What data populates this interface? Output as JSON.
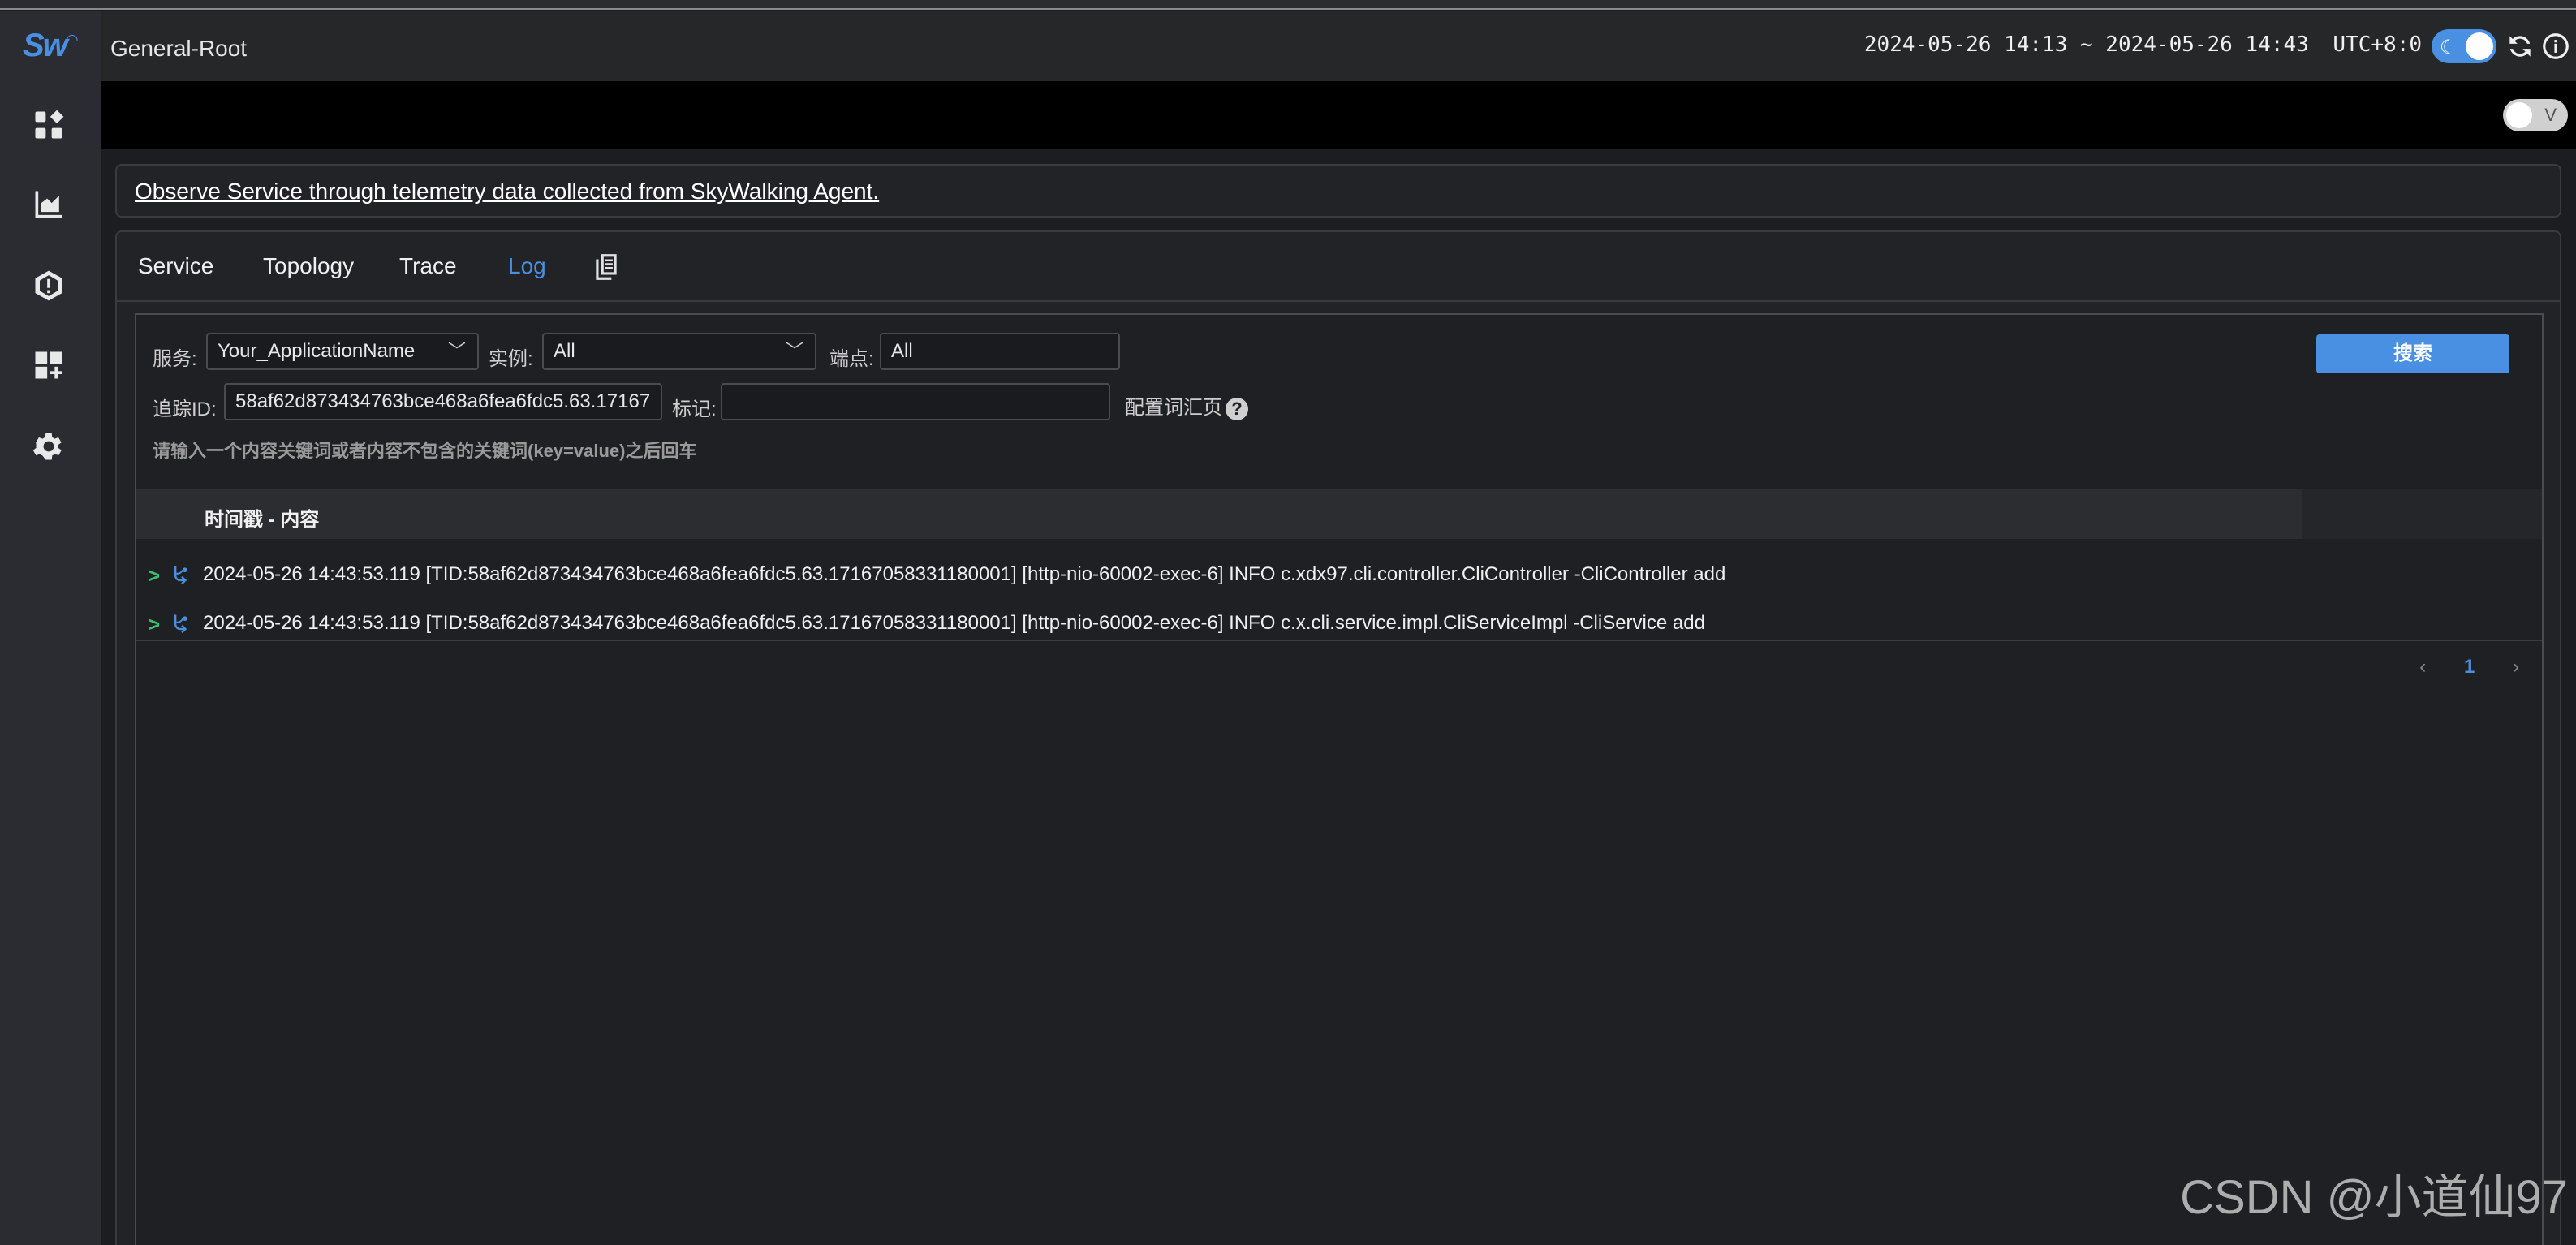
{
  "header": {
    "breadcrumb": "General-Root",
    "time_range": "2024-05-26 14:13 ~ 2024-05-26 14:43",
    "timezone": "UTC+8:0"
  },
  "toggle_label": "V",
  "description": "Observe Service through telemetry data collected from SkyWalking Agent.",
  "tabs": [
    {
      "label": "Service"
    },
    {
      "label": "Topology"
    },
    {
      "label": "Trace"
    },
    {
      "label": "Log",
      "active": true
    }
  ],
  "filters": {
    "service_label": "服务:",
    "service_value": "Your_ApplicationName",
    "instance_label": "实例:",
    "instance_value": "All",
    "endpoint_label": "端点:",
    "endpoint_value": "All",
    "trace_id_label": "追踪ID:",
    "trace_id_value": "58af62d873434763bce468a6fea6fdc5.63.17167",
    "tags_label": "标记:",
    "tags_value": "",
    "config_link": "配置词汇页",
    "help_symbol": "?",
    "hint": "请输入一个内容关键词或者内容不包含的关键词(key=value)之后回车",
    "search_button": "搜索"
  },
  "table": {
    "column": "时间戳 - 内容",
    "rows": [
      {
        "expand": ">",
        "text": "2024-05-26 14:43:53.119 [TID:58af62d873434763bce468a6fea6fdc5.63.17167058331180001] [http-nio-60002-exec-6] INFO c.xdx97.cli.controller.CliController -CliController add"
      },
      {
        "expand": ">",
        "text": "2024-05-26 14:43:53.119 [TID:58af62d873434763bce468a6fea6fdc5.63.17167058331180001] [http-nio-60002-exec-6] INFO c.x.cli.service.impl.CliServiceImpl -CliService add"
      }
    ]
  },
  "pagination": {
    "prev": "‹",
    "current": "1",
    "next": "›"
  },
  "watermark": "CSDN @小道仙97",
  "colors": {
    "accent": "#4a90e2",
    "expand": "#3bbf6a"
  }
}
